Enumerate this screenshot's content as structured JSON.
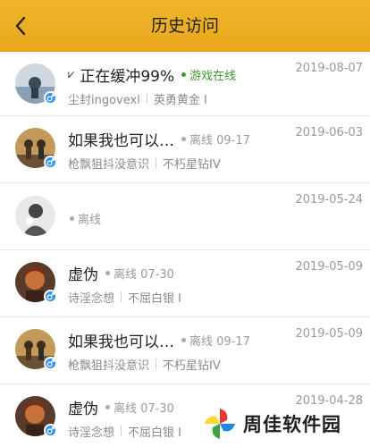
{
  "header": {
    "title": "历史访问"
  },
  "visits": [
    {
      "nickname": "正在缓冲99%",
      "status": "游戏在线",
      "status_type": "online",
      "signature": "尘封ingovexl",
      "rank": "英勇黄金 I",
      "date": "2019-08-07"
    },
    {
      "nickname": "如果我也可以…",
      "status": "离线 09-17",
      "status_type": "offline",
      "signature": "枪飘狙抖没意识",
      "rank": "不朽星钻IV",
      "date": "2019-06-03"
    },
    {
      "nickname": "",
      "status": "离线",
      "status_type": "offline",
      "signature": "",
      "rank": "",
      "date": "2019-05-24"
    },
    {
      "nickname": "虚伪",
      "status": "离线 07-30",
      "status_type": "offline",
      "signature": "诗淫念想",
      "rank": "不屈白银 I",
      "date": "2019-05-09"
    },
    {
      "nickname": "如果我也可以…",
      "status": "离线 09-17",
      "status_type": "offline",
      "signature": "枪飘狙抖没意识",
      "rank": "不朽星钻IV",
      "date": "2019-05-09"
    },
    {
      "nickname": "虚伪",
      "status": "离线 07-30",
      "status_type": "offline",
      "signature": "诗淫念想",
      "rank": "不屈白银 I",
      "date": "2019-04-28"
    }
  ],
  "watermark": {
    "text": "周佳软件园"
  },
  "colors": {
    "header": "#eaaa20",
    "online": "#3c9a2e",
    "badge": "#2f8ff5"
  }
}
